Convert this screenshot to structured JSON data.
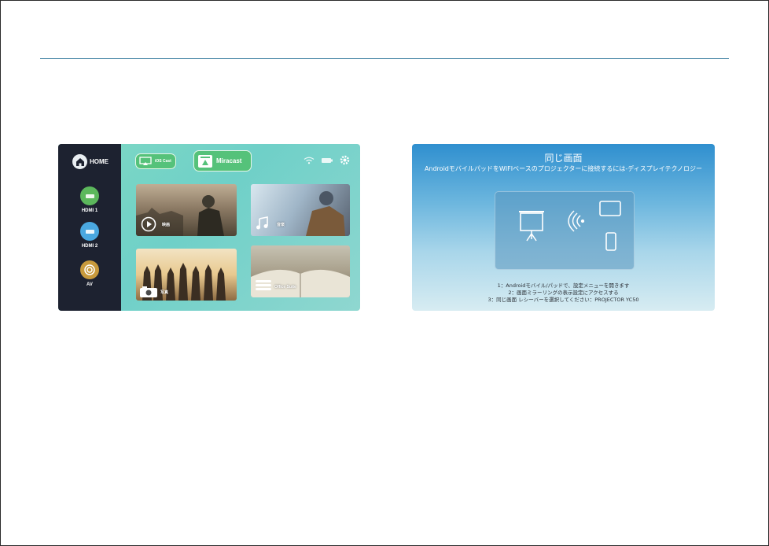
{
  "colors": {
    "rule": "#4a88a8",
    "sidebar": "#1d2230",
    "hdmi1": "#5cb85c",
    "hdmi2": "#4aa8e0",
    "av": "#c89a3c",
    "cast_green": "#55c27a"
  },
  "home_screen": {
    "home_label": "HOME",
    "sources": [
      {
        "label": "HDMI 1",
        "icon": "hdmi-port-icon"
      },
      {
        "label": "HDMI 2",
        "icon": "hdmi-port-icon"
      },
      {
        "label": "AV",
        "icon": "av-ring-icon"
      }
    ],
    "ios_cast_label": "iOS Cast",
    "miracast_label": "Miracast",
    "tiles": {
      "movie": "映画",
      "music": "音楽",
      "photo": "写真",
      "office": "Office Suite"
    }
  },
  "mirror_screen": {
    "title": "同じ画面",
    "subtitle": "AndroidモバイルパッドをWIFIベースのプロジェクターに接続するには-ディスプレイテクノロジー",
    "steps": [
      "1：Androidモバイル/パッドで、設定メニューを開きます",
      "2：画面ミラーリングの表示設定にアクセスする",
      "3：同じ画面 レシーバーを選択してください：PROJECTOR YC50"
    ]
  }
}
